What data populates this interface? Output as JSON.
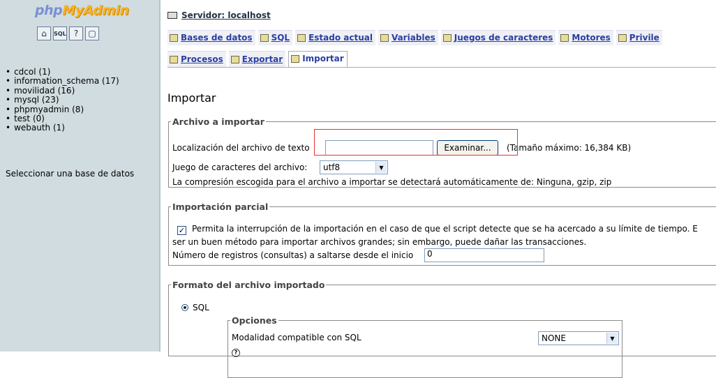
{
  "sidebar": {
    "logo_php": "php",
    "logo_myadmin": "MyAdmin",
    "icons": [
      "home-icon",
      "sql-query-icon",
      "docs-icon",
      "query-window-icon"
    ],
    "databases": [
      "cdcol (1)",
      "information_schema (17)",
      "movilidad (16)",
      "mysql (23)",
      "phpmyadmin (8)",
      "test (0)",
      "webauth (1)"
    ],
    "select_db": "Seleccionar una base de datos"
  },
  "header": {
    "server": "Servidor: localhost"
  },
  "tabs": {
    "row1": [
      "Bases de datos",
      "SQL",
      "Estado actual",
      "Variables",
      "Juegos de caracteres",
      "Motores",
      "Privile"
    ],
    "row2": [
      "Procesos",
      "Exportar",
      "Importar"
    ]
  },
  "page": {
    "title": "Importar",
    "file_section": {
      "legend": "Archivo a importar",
      "location_label": "Localización del archivo de texto",
      "browse_button": "Examinar...",
      "max_size": "(Tamaño máximo: 16,384 KB)",
      "charset_label": "Juego de caracteres del archivo:",
      "charset_value": "utf8",
      "compression_note": "La compresión escogida para el archivo a importar se detectará automáticamente de: Ninguna, gzip, zip"
    },
    "partial_section": {
      "legend": "Importación parcial",
      "allow_interrupt": "Permita la interrupción de la importación en el caso de que el script detecte que se ha acercado a su límite de tiempo. E",
      "interrupt_note": "ser un buen método para importar archivos grandes; sin embargo, puede dañar las transacciones.",
      "skip_label": "Número de registros (consultas) a saltarse desde el inicio",
      "skip_value": "0"
    },
    "format_section": {
      "legend": "Formato del archivo importado",
      "format_sql": "SQL",
      "options_legend": "Opciones",
      "compat_label": "Modalidad compatible con SQL",
      "compat_value": "NONE"
    }
  }
}
